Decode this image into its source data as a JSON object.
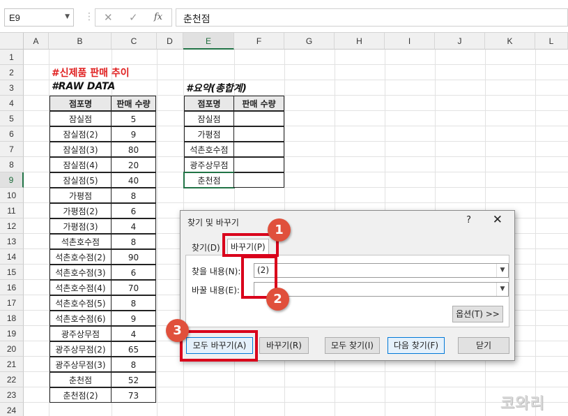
{
  "formula_bar": {
    "name_box": "E9",
    "cancel_icon": "✕",
    "enter_icon": "✓",
    "fx_label": "fx",
    "formula_value": "춘천점"
  },
  "columns": [
    "A",
    "B",
    "C",
    "D",
    "E",
    "F",
    "G",
    "H",
    "I",
    "J",
    "K",
    "L"
  ],
  "rows": [
    "1",
    "2",
    "3",
    "4",
    "5",
    "6",
    "7",
    "8",
    "9",
    "10",
    "11",
    "12",
    "13",
    "14",
    "15",
    "16",
    "17",
    "18",
    "19",
    "20",
    "21",
    "22",
    "23",
    "24"
  ],
  "sheet": {
    "title": "#신제품 판매 추이",
    "raw_title": "#RAW DATA",
    "summary_title": "#요약(총합계)",
    "raw_headers": [
      "점포명",
      "판매 수량"
    ],
    "raw_rows": [
      [
        "잠실점",
        "5"
      ],
      [
        "잠실점(2)",
        "9"
      ],
      [
        "잠실점(3)",
        "80"
      ],
      [
        "잠실점(4)",
        "20"
      ],
      [
        "잠실점(5)",
        "40"
      ],
      [
        "가평점",
        "8"
      ],
      [
        "가평점(2)",
        "6"
      ],
      [
        "가평점(3)",
        "4"
      ],
      [
        "석촌호수점",
        "8"
      ],
      [
        "석촌호수점(2)",
        "90"
      ],
      [
        "석촌호수점(3)",
        "6"
      ],
      [
        "석촌호수점(4)",
        "70"
      ],
      [
        "석촌호수점(5)",
        "8"
      ],
      [
        "석촌호수점(6)",
        "9"
      ],
      [
        "광주상무점",
        "4"
      ],
      [
        "광주상무점(2)",
        "65"
      ],
      [
        "광주상무점(3)",
        "8"
      ],
      [
        "춘천점",
        "52"
      ],
      [
        "춘천점(2)",
        "73"
      ]
    ],
    "summary_headers": [
      "점포명",
      "판매 수량"
    ],
    "summary_rows": [
      [
        "잠실점",
        ""
      ],
      [
        "가평점",
        ""
      ],
      [
        "석촌호수점",
        ""
      ],
      [
        "광주상무점",
        ""
      ],
      [
        "춘천점",
        ""
      ]
    ]
  },
  "dialog": {
    "title": "찾기 및 바꾸기",
    "help": "?",
    "close": "✕",
    "tab_find": "찾기(D)",
    "tab_replace": "바꾸기(P)",
    "find_label": "찾을 내용(N):",
    "find_value": "(2)",
    "replace_label": "바꿀 내용(E):",
    "replace_value": "",
    "options_button": "옵션(T) >>",
    "replace_all": "모두 바꾸기(A)",
    "replace": "바꾸기(R)",
    "find_all": "모두 찾기(I)",
    "find_next": "다음 찾기(F)",
    "close_button": "닫기"
  },
  "annotations": {
    "badge1": "1",
    "badge2": "2",
    "badge3": "3",
    "accent": "#d9001b"
  },
  "watermark": "코와리"
}
